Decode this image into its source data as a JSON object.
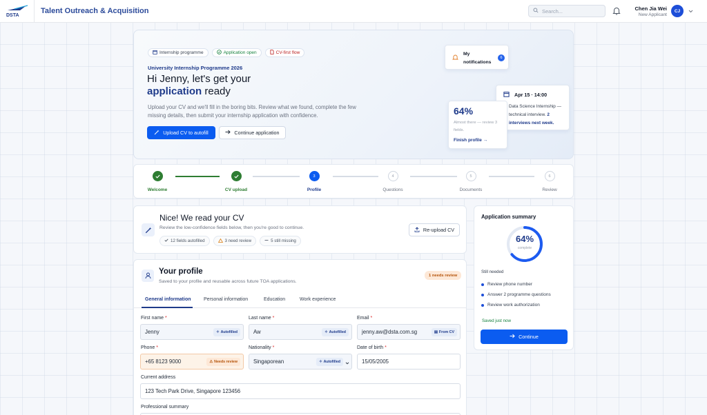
{
  "header": {
    "logo_text": "DSTA",
    "app_title": "Talent Outreach & Acquisition",
    "search_placeholder": "Search...",
    "user_name": "Chen Jia Wei",
    "user_role": "New Applicant",
    "user_initials": "CJ"
  },
  "hero": {
    "pills": [
      {
        "label": "Internship programme",
        "icon": "calendar-icon"
      },
      {
        "label": "Application open",
        "icon": "check-circle-icon"
      },
      {
        "label": "CV-first flow",
        "icon": "document-icon"
      }
    ],
    "programme": "University Internship Programme 2026",
    "heading_line1": "Hi Jenny, let's get your",
    "heading_accent": "application",
    "heading_rest": " ready",
    "description": "Upload your CV and we'll fill in the boring bits. Review what we found, complete the few missing details, then submit your internship application with confidence.",
    "upload_button": "Upload CV to autofill",
    "continue_button": "Continue application",
    "notifications_label": "My notifications",
    "notifications_count": "6",
    "date_card": {
      "date": "Apr 15 · 14:00",
      "text_pre": "Data Science Internship — technical interview. ",
      "text_bold": "2 interviews next week."
    },
    "progress_card": {
      "value": "64%",
      "subtitle": "Almost there — review 3 fields.",
      "link": "Finish profile"
    }
  },
  "stepper": {
    "steps": [
      {
        "label": "Welcome",
        "state": "done"
      },
      {
        "label": "CV upload",
        "state": "done"
      },
      {
        "label": "Profile",
        "state": "current",
        "number": "3"
      },
      {
        "label": "Questions",
        "state": "todo",
        "number": "4"
      },
      {
        "label": "Documents",
        "state": "todo",
        "number": "5"
      },
      {
        "label": "Review",
        "state": "todo",
        "number": "6"
      }
    ]
  },
  "cv": {
    "title": "Nice! We read your CV",
    "subtitle": "Review the low-confidence fields below, then you're good to continue.",
    "chips": [
      "12 fields autofilled",
      "3 need review",
      "5 still missing"
    ],
    "reupload_button": "Re-upload CV"
  },
  "profile": {
    "title": "Your profile",
    "subtitle": "Saved to your profile and reusable across future TOA applications.",
    "review_badge": "1 needs review",
    "tabs": [
      "General information",
      "Personal information",
      "Education",
      "Work experience"
    ],
    "fields": {
      "first_name": {
        "label": "First name",
        "value": "Jenny",
        "tag": "Autofilled"
      },
      "last_name": {
        "label": "Last name",
        "value": "Aw",
        "tag": "Autofilled"
      },
      "email": {
        "label": "Email",
        "value": "jenny.aw@dsta.com.sg",
        "tag": "From CV"
      },
      "phone": {
        "label": "Phone",
        "value": "+65 8123 9000",
        "tag": "Needs review"
      },
      "nationality": {
        "label": "Nationality",
        "value": "Singaporean",
        "tag": "Autofilled"
      },
      "dob": {
        "label": "Date of birth",
        "value": "15/05/2005"
      },
      "address": {
        "label": "Current address",
        "value": "123 Tech Park Drive, Singapore 123456"
      },
      "summary": {
        "label": "Professional summary"
      }
    }
  },
  "summary": {
    "title": "Application summary",
    "progress_value": "64%",
    "progress_fraction": 0.64,
    "progress_sub": "complete",
    "still_needed_label": "Still needed",
    "needs": [
      "Review phone number",
      "Answer 2 programme questions",
      "Review work authorization"
    ],
    "saved": "Saved just now",
    "continue_button": "Continue"
  },
  "colors": {
    "primary": "#0b5cf0",
    "brand_navy": "#1e3a8a",
    "success": "#2e7d32",
    "warning": "#b45309"
  }
}
